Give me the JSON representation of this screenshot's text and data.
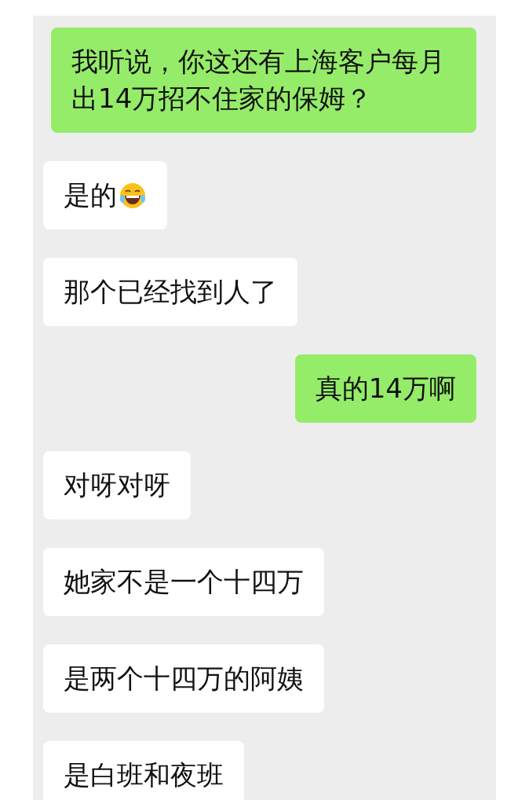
{
  "messages": [
    {
      "kind": "sent",
      "text": "我听说，你这还有上海客户每月出14万招不住家的保姆？",
      "has_emoji": false
    },
    {
      "kind": "received",
      "text": "是的",
      "has_emoji": true
    },
    {
      "kind": "received",
      "text": "那个已经找到人了",
      "has_emoji": false
    },
    {
      "kind": "sent",
      "text": "真的14万啊",
      "has_emoji": false
    },
    {
      "kind": "received",
      "text": "对呀对呀",
      "has_emoji": false
    },
    {
      "kind": "received",
      "text": "她家不是一个十四万",
      "has_emoji": false
    },
    {
      "kind": "received",
      "text": "是两个十四万的阿姨",
      "has_emoji": false
    },
    {
      "kind": "received",
      "text": "是白班和夜班",
      "has_emoji": false
    }
  ]
}
